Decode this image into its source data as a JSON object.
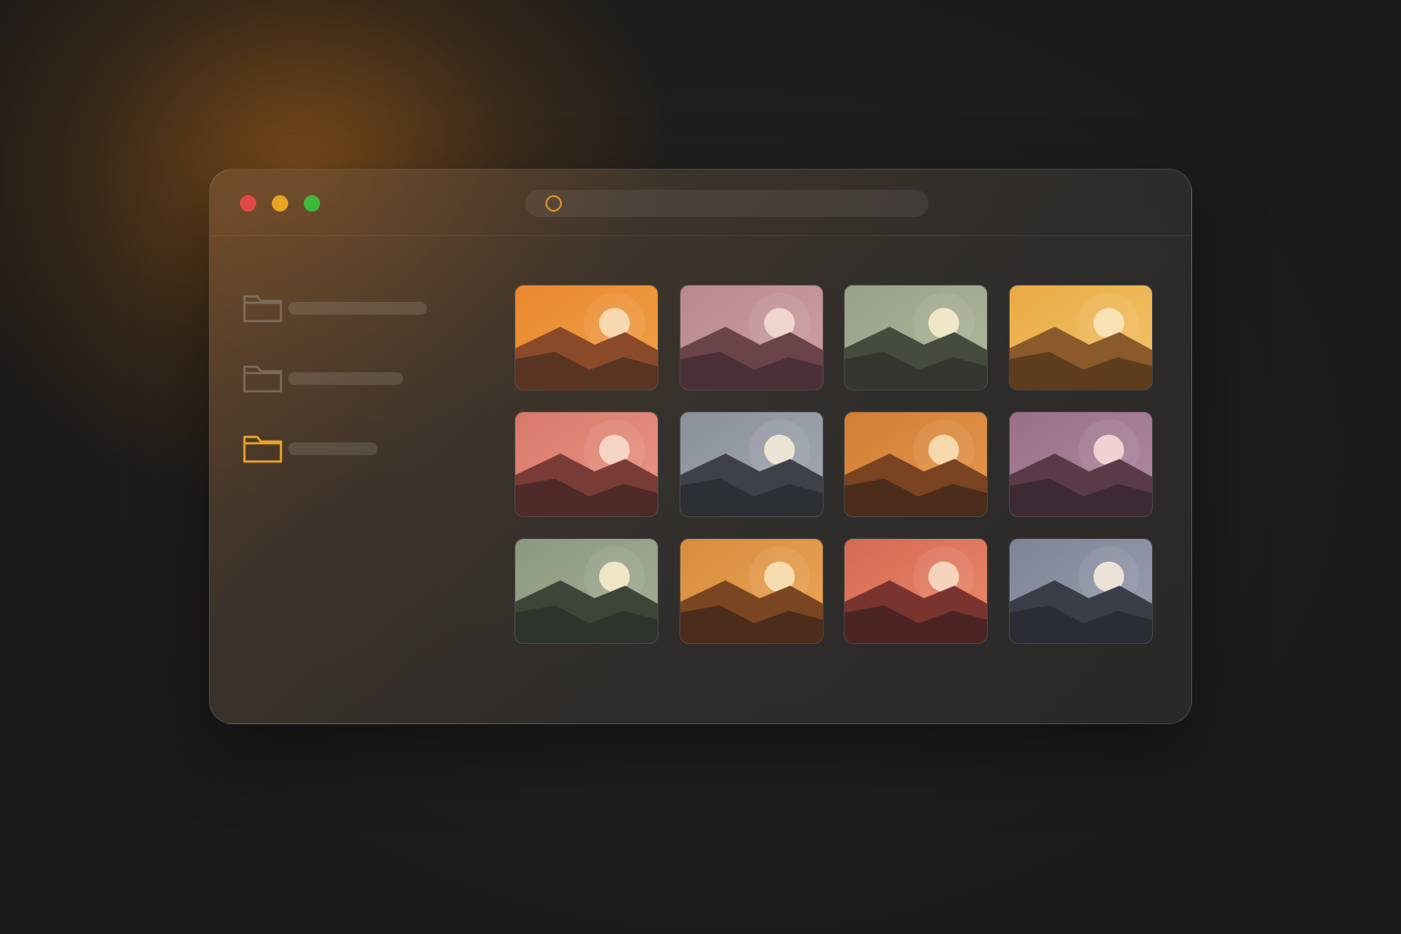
{
  "window": {
    "controls": [
      {
        "name": "close",
        "color": "#e04848"
      },
      {
        "name": "minimize",
        "color": "#e8a224"
      },
      {
        "name": "zoom",
        "color": "#3db83a"
      }
    ],
    "address_bar": {
      "icon": "circle-icon",
      "accent": "#d89028",
      "value": ""
    }
  },
  "sidebar": {
    "folders": [
      {
        "icon": "folder-icon",
        "label": "",
        "selected": false
      },
      {
        "icon": "folder-icon",
        "label": "",
        "selected": false
      },
      {
        "icon": "folder-icon",
        "label": "",
        "selected": true
      }
    ],
    "accent": "#e8a224"
  },
  "gallery": {
    "thumbnails": [
      {
        "icon": "image-icon",
        "sky": [
          "#e8882e",
          "#f2a248"
        ],
        "sun": "#f8d8b0",
        "far": "#8a4a2a",
        "near": "#5a3422"
      },
      {
        "icon": "image-icon",
        "sky": [
          "#b88890",
          "#cfa0a2"
        ],
        "sun": "#f0d4ce",
        "far": "#6a4448",
        "near": "#4a3036"
      },
      {
        "icon": "image-icon",
        "sky": [
          "#98a088",
          "#b0b89c"
        ],
        "sun": "#efe8c8",
        "far": "#454b3e",
        "near": "#33372f"
      },
      {
        "icon": "image-icon",
        "sky": [
          "#e8aa44",
          "#f4c46a"
        ],
        "sun": "#fae2b4",
        "far": "#8a5a2a",
        "near": "#5e3c1e"
      },
      {
        "icon": "image-icon",
        "sky": [
          "#d8786a",
          "#ea9888"
        ],
        "sun": "#f6d4c4",
        "far": "#7a3c36",
        "near": "#4e2a28"
      },
      {
        "icon": "image-icon",
        "sky": [
          "#8a909a",
          "#a4aab4"
        ],
        "sun": "#ece4d2",
        "far": "#3e4248",
        "near": "#2c2f34"
      },
      {
        "icon": "image-icon",
        "sky": [
          "#d27e34",
          "#e6984c"
        ],
        "sun": "#f6d8aa",
        "far": "#7a4422",
        "near": "#4c2c1a"
      },
      {
        "icon": "image-icon",
        "sky": [
          "#9a7088",
          "#b08aa0"
        ],
        "sun": "#f0d2d2",
        "far": "#5a3a48",
        "near": "#3e2a34"
      },
      {
        "icon": "image-icon",
        "sky": [
          "#8c9880",
          "#a4ae94"
        ],
        "sun": "#efe6c6",
        "far": "#3e4538",
        "near": "#2e332b"
      },
      {
        "icon": "image-icon",
        "sky": [
          "#d88c3e",
          "#eca656"
        ],
        "sun": "#f6dcae",
        "far": "#7a4622",
        "near": "#4c2c1a"
      },
      {
        "icon": "image-icon",
        "sky": [
          "#d66a52",
          "#ea8a6c"
        ],
        "sun": "#f6d4bc",
        "far": "#7a3430",
        "near": "#4c2424"
      },
      {
        "icon": "image-icon",
        "sky": [
          "#7e8496",
          "#9aa0b0"
        ],
        "sun": "#ece2d8",
        "far": "#3a3e48",
        "near": "#2a2d33"
      }
    ]
  }
}
